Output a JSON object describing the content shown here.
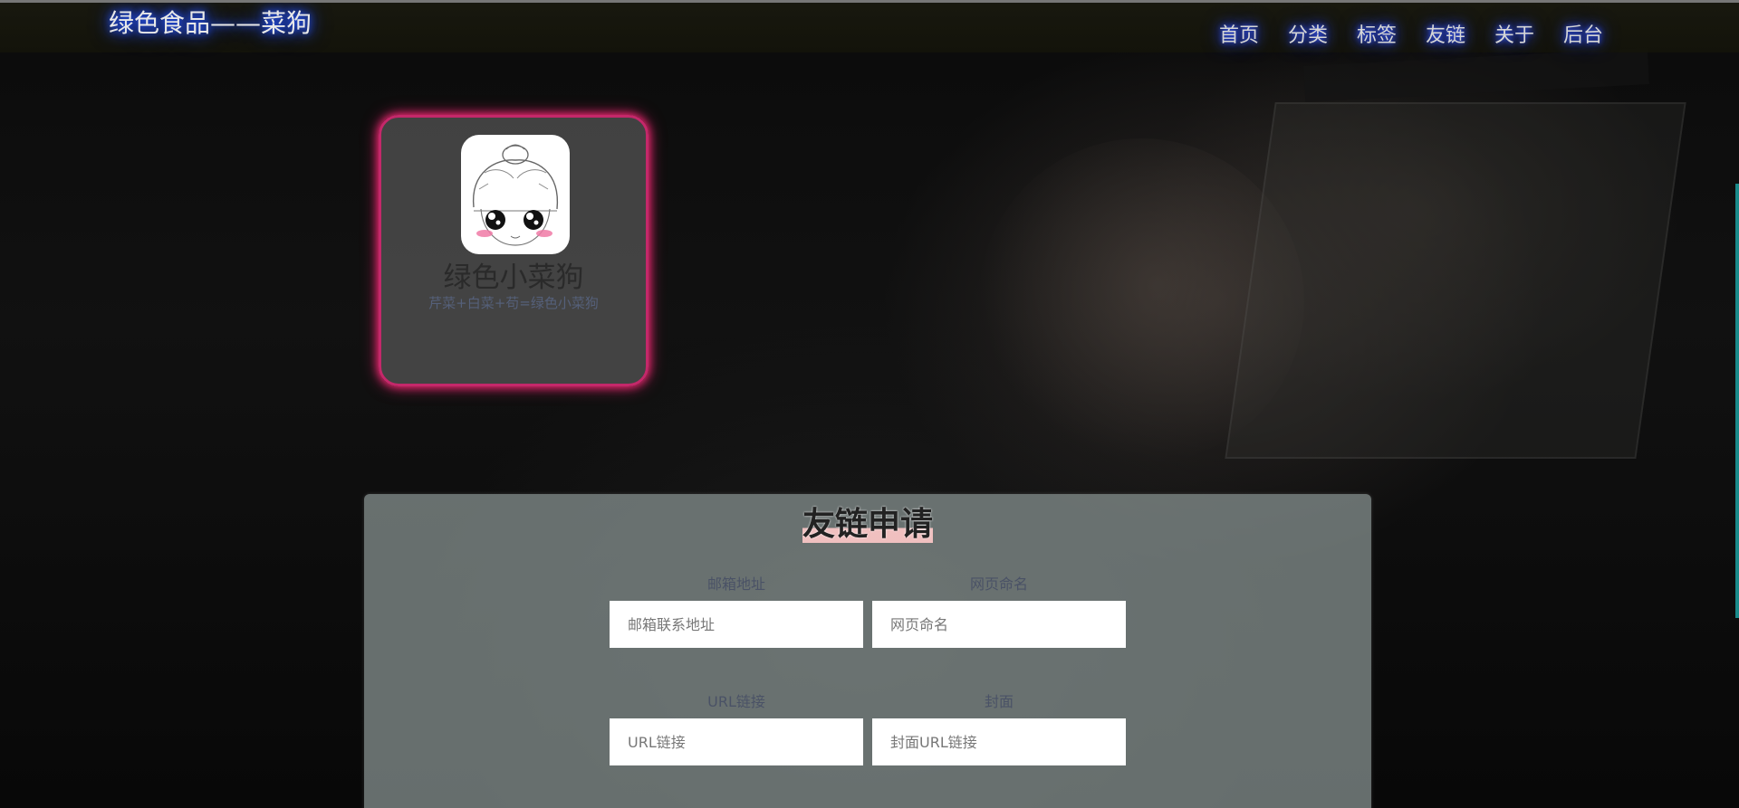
{
  "header": {
    "brand": "绿色食品——菜狗",
    "nav": [
      {
        "label": "首页"
      },
      {
        "label": "分类"
      },
      {
        "label": "标签"
      },
      {
        "label": "友链"
      },
      {
        "label": "关于"
      },
      {
        "label": "后台"
      }
    ]
  },
  "profile": {
    "name": "绿色小菜狗",
    "description": "芹菜+白菜+苟=绿色小菜狗",
    "avatar_icon": "cartoon-girl-avatar"
  },
  "form": {
    "title": "友链申请",
    "fields": [
      {
        "label": "邮箱地址",
        "placeholder": "邮箱联系地址"
      },
      {
        "label": "网页命名",
        "placeholder": "网页命名"
      },
      {
        "label": "URL链接",
        "placeholder": "URL链接"
      },
      {
        "label": "封面",
        "placeholder": "封面URL链接"
      }
    ]
  },
  "colors": {
    "card_border": "#c4286a",
    "nav_glow": "#2a5cff",
    "form_bg": "#828c8a",
    "edge_accent": "#1a8a8a"
  }
}
